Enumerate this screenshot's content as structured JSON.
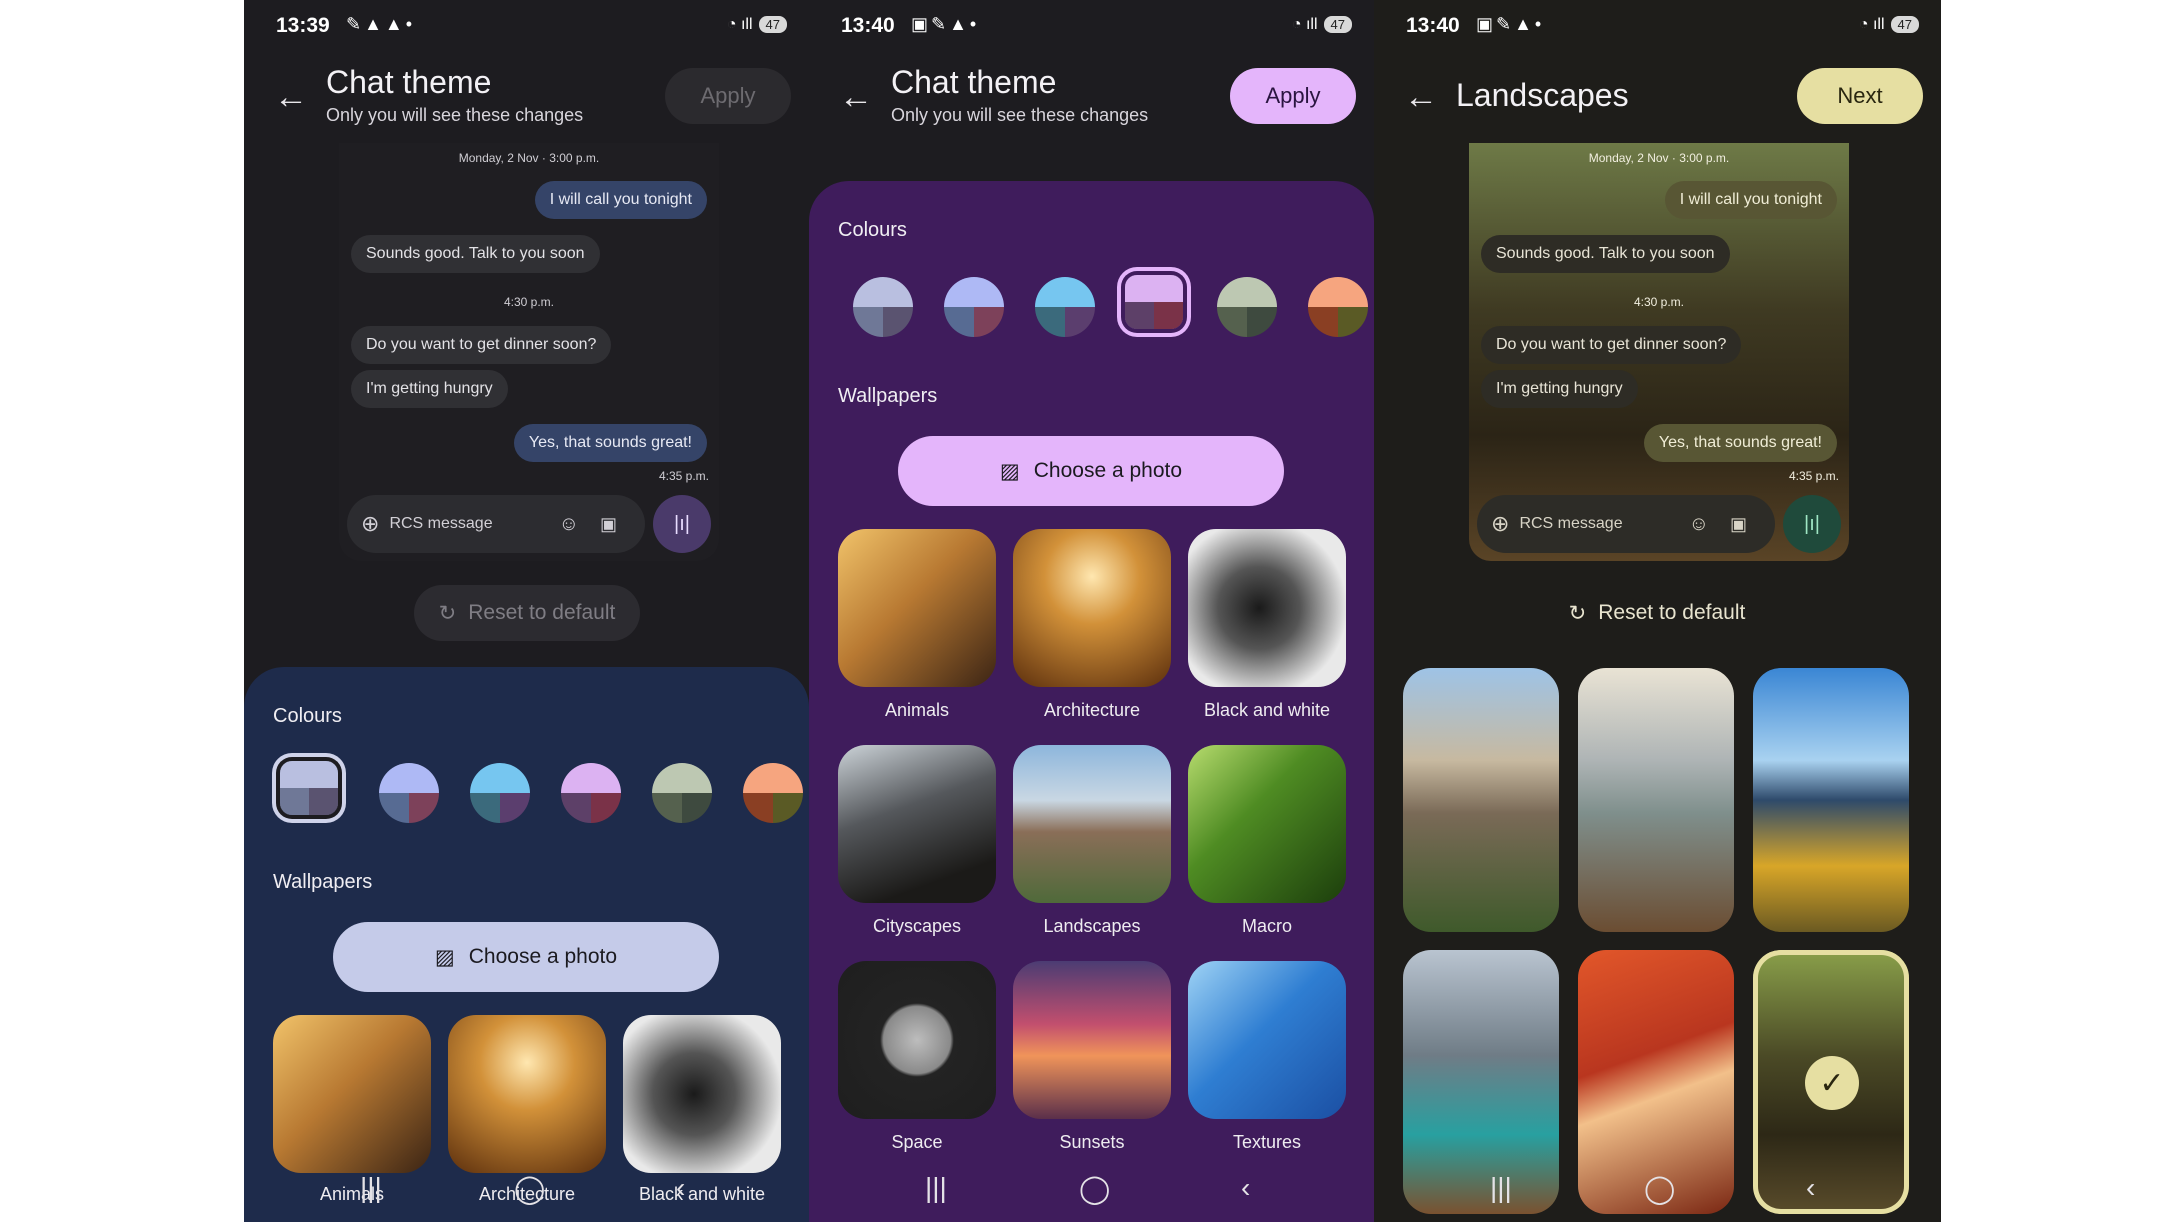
{
  "status_bar": [
    {
      "time": "13:39",
      "battery": "47"
    },
    {
      "time": "13:40",
      "battery": "47"
    },
    {
      "time": "13:40",
      "battery": "47"
    }
  ],
  "screen1": {
    "title": "Chat theme",
    "subtitle": "Only you will see these changes",
    "apply": "Apply",
    "reset": "Reset to default",
    "colours_label": "Colours",
    "wallpapers_label": "Wallpapers",
    "choose_photo": "Choose a photo",
    "wallpapers": [
      "Animals",
      "Architecture",
      "Black and white"
    ]
  },
  "screen2": {
    "title": "Chat theme",
    "subtitle": "Only you will see these changes",
    "apply": "Apply",
    "colours_label": "Colours",
    "wallpapers_label": "Wallpapers",
    "choose_photo": "Choose a photo",
    "wallpapers": [
      "Animals",
      "Architecture",
      "Black and white",
      "Cityscapes",
      "Landscapes",
      "Macro",
      "Space",
      "Sunsets",
      "Textures"
    ]
  },
  "screen3": {
    "title": "Landscapes",
    "next": "Next",
    "reset": "Reset to default"
  },
  "preview": {
    "date": "Monday, 2 Nov · 3:00 p.m.",
    "msg1": "I will call you tonight",
    "msg2": "Sounds good. Talk to you soon",
    "time2": "4:30 p.m.",
    "msg3": "Do you want to get dinner soon?",
    "msg4": "I'm getting hungry",
    "msg5": "Yes, that sounds great!",
    "time3": "4:35 p.m.",
    "compose_placeholder": "RCS message"
  },
  "colors": {
    "accent_lavender": "#c5cbe9",
    "accent_purple": "#e4b5fb",
    "accent_olive": "#e6dfa2",
    "sheet_blue": "#1e2b4b",
    "sheet_purple": "#3f1c5c"
  }
}
